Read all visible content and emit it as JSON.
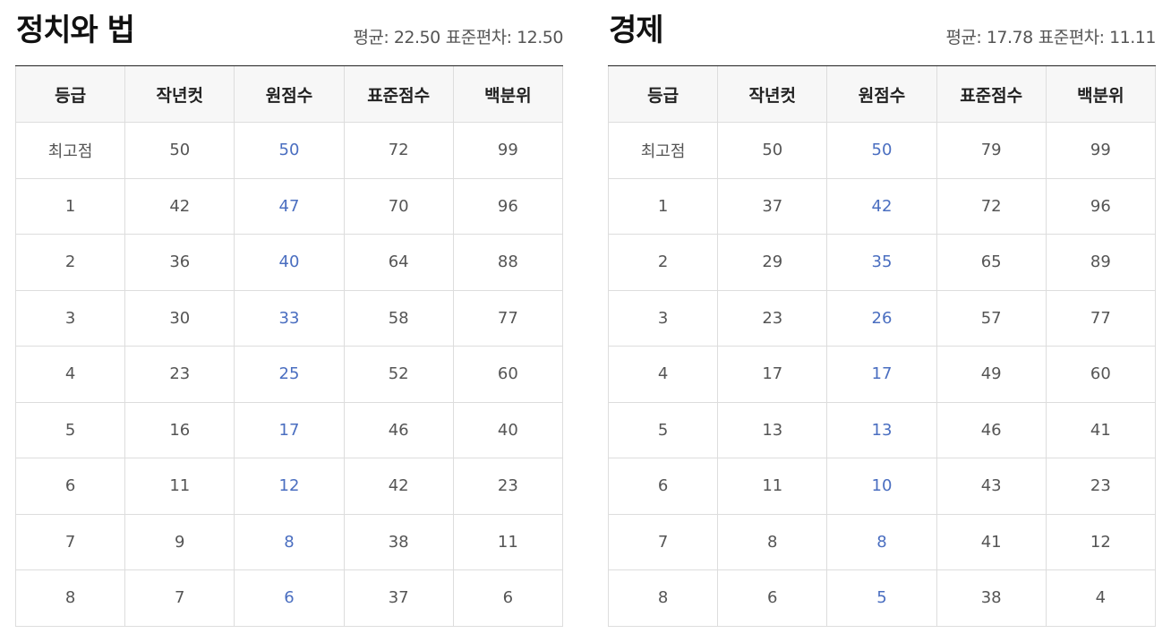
{
  "columns": [
    "등급",
    "작년컷",
    "원점수",
    "표준점수",
    "백분위"
  ],
  "panels": [
    {
      "title": "정치와 법",
      "mean_label": "평균: 22.50",
      "sd_label": "표준편차: 12.50",
      "rows": [
        [
          "최고점",
          "50",
          "50",
          "72",
          "99"
        ],
        [
          "1",
          "42",
          "47",
          "70",
          "96"
        ],
        [
          "2",
          "36",
          "40",
          "64",
          "88"
        ],
        [
          "3",
          "30",
          "33",
          "58",
          "77"
        ],
        [
          "4",
          "23",
          "25",
          "52",
          "60"
        ],
        [
          "5",
          "16",
          "17",
          "46",
          "40"
        ],
        [
          "6",
          "11",
          "12",
          "42",
          "23"
        ],
        [
          "7",
          "9",
          "8",
          "38",
          "11"
        ],
        [
          "8",
          "7",
          "6",
          "37",
          "6"
        ]
      ]
    },
    {
      "title": "경제",
      "mean_label": "평균: 17.78",
      "sd_label": "표준편차: 11.11",
      "rows": [
        [
          "최고점",
          "50",
          "50",
          "79",
          "99"
        ],
        [
          "1",
          "37",
          "42",
          "72",
          "96"
        ],
        [
          "2",
          "29",
          "35",
          "65",
          "89"
        ],
        [
          "3",
          "23",
          "26",
          "57",
          "77"
        ],
        [
          "4",
          "17",
          "17",
          "49",
          "60"
        ],
        [
          "5",
          "13",
          "13",
          "46",
          "41"
        ],
        [
          "6",
          "11",
          "10",
          "43",
          "23"
        ],
        [
          "7",
          "8",
          "8",
          "41",
          "12"
        ],
        [
          "8",
          "6",
          "5",
          "38",
          "4"
        ]
      ]
    }
  ],
  "colors": {
    "raw_score": "#4a6ec0",
    "header_bg": "#f7f7f7",
    "border": "#dddddd",
    "title_rule": "#222222"
  }
}
